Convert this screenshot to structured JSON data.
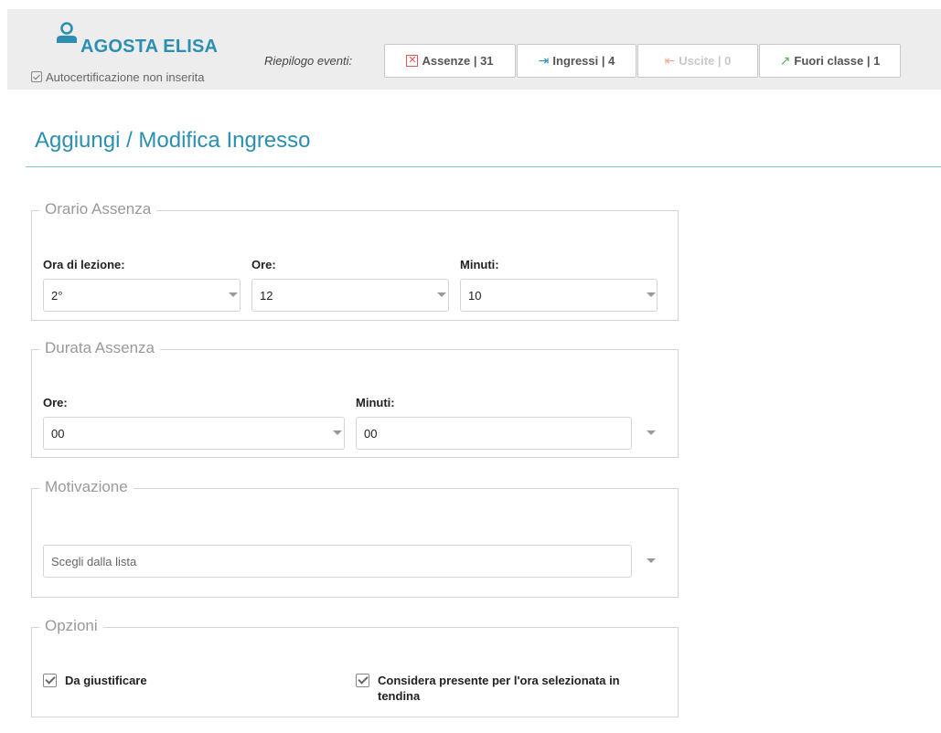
{
  "header": {
    "student_name": "AGOSTA ELISA",
    "autocert": "Autocertificazione non inserita",
    "riepilogo_label": "Riepilogo eventi:",
    "events": {
      "assenze": "Assenze | 31",
      "ingressi": "Ingressi | 4",
      "uscite": "Uscite | 0",
      "fuori_classe": "Fuori classe | 1"
    },
    "icons": {
      "user": "user-icon",
      "assenze": "x-box-icon",
      "ingressi": "sign-in-icon",
      "uscite": "sign-out-icon",
      "fuori_classe": "external-link-icon"
    },
    "colors": {
      "accent": "#2b8fb3",
      "assenze": "#e05555",
      "fuori_classe": "#5aa95a",
      "uscite_disabled": "#f0a98e"
    }
  },
  "page_title": "Aggiungi / Modifica Ingresso",
  "orario": {
    "legend": "Orario Assenza",
    "ora_label": "Ora di lezione:",
    "ora_value": "2°",
    "ore_label": "Ore:",
    "ore_value": "12",
    "minuti_label": "Minuti:",
    "minuti_value": "10"
  },
  "durata": {
    "legend": "Durata Assenza",
    "ore_label": "Ore:",
    "ore_value": "00",
    "minuti_label": "Minuti:",
    "minuti_value": "00"
  },
  "motivazione": {
    "legend": "Motivazione",
    "placeholder": "Scegli dalla lista"
  },
  "opzioni": {
    "legend": "Opzioni",
    "da_giustificare": "Da giustificare",
    "considera_line1": "Considera presente per l'ora selezionata in",
    "considera_line2": "tendina"
  }
}
